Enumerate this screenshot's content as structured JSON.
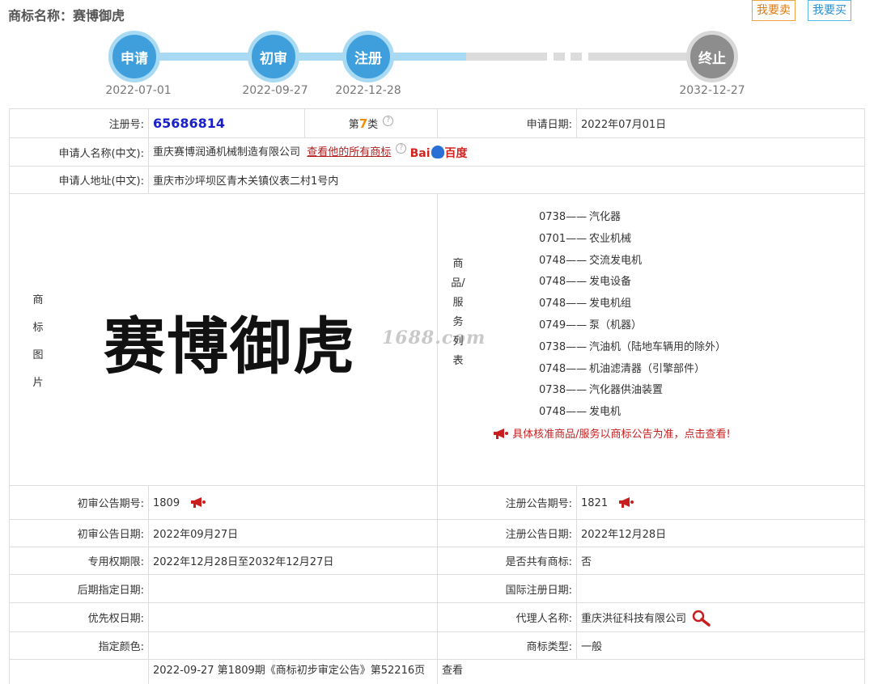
{
  "header": {
    "label": "商标名称：",
    "name": "赛博御虎",
    "sell_btn": "我要卖",
    "buy_btn": "我要买"
  },
  "timeline": [
    {
      "label": "申请",
      "date": "2022-07-01"
    },
    {
      "label": "初审",
      "date": "2022-09-27"
    },
    {
      "label": "注册",
      "date": "2022-12-28"
    },
    {
      "label": "终止",
      "date": "2032-12-27"
    }
  ],
  "info": {
    "reg_no_label": "注册号:",
    "reg_no": "65686814",
    "class_prefix": "第",
    "class_num": "7",
    "class_suffix": "类",
    "apply_date_label": "申请日期:",
    "apply_date": "2022年07月01日",
    "applicant_label": "申请人名称(中文):",
    "applicant": "重庆赛博润通机械制造有限公司",
    "view_all_link": "查看他的所有商标",
    "baidu_a": "Bai",
    "baidu_b": "百度",
    "address_label": "申请人地址(中文):",
    "address": "重庆市沙坪坝区青木关镇仪表二村1号内",
    "image_label": "商标图片",
    "mark_text": "赛博御虎",
    "watermark": "1688.com",
    "services_label": "商品/服务列表",
    "services": [
      {
        "code": "0738——",
        "name": "汽化器"
      },
      {
        "code": "0701——",
        "name": "农业机械"
      },
      {
        "code": "0748——",
        "name": "交流发电机"
      },
      {
        "code": "0748——",
        "name": "发电设备"
      },
      {
        "code": "0748——",
        "name": "发电机组"
      },
      {
        "code": "0749——",
        "name": "泵（机器）"
      },
      {
        "code": "0738——",
        "name": "汽油机（陆地车辆用的除外）"
      },
      {
        "code": "0748——",
        "name": "机油滤清器（引擎部件）"
      },
      {
        "code": "0738——",
        "name": "汽化器供油装置"
      },
      {
        "code": "0748——",
        "name": "发电机"
      }
    ],
    "notice": "具体核准商品/服务以商标公告为准，点击查看!",
    "prelim_no_label": "初审公告期号:",
    "prelim_no": "1809",
    "reg_notice_no_label": "注册公告期号:",
    "reg_notice_no": "1821",
    "prelim_date_label": "初审公告日期:",
    "prelim_date": "2022年09月27日",
    "reg_notice_date_label": "注册公告日期:",
    "reg_notice_date": "2022年12月28日",
    "exclusive_label": "专用权期限:",
    "exclusive": "2022年12月28日至2032年12月27日",
    "shared_label": "是否共有商标:",
    "shared": "否",
    "later_label": "后期指定日期:",
    "later": "",
    "intl_label": "国际注册日期:",
    "intl": "",
    "priority_label": "优先权日期:",
    "priority": "",
    "agent_label": "代理人名称:",
    "agent": "重庆洪征科技有限公司",
    "color_label": "指定颜色:",
    "color": "",
    "type_label": "商标类型:",
    "type": "一般",
    "last_row": "2022-09-27 第1809期《商标初步审定公告》第52216页",
    "last_row_view": "查看"
  },
  "colors": {
    "accent_blue": "#3f9fdc",
    "gray": "#8d8d8d",
    "red": "#c81e1e",
    "orange": "#f08c00"
  }
}
